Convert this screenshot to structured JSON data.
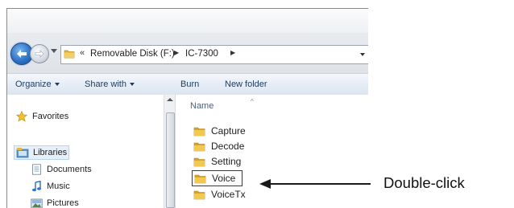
{
  "window": {
    "address": {
      "overflow": "«",
      "crumbs": [
        "Removable Disk (F:)",
        "IC-7300"
      ],
      "separator": "▶"
    },
    "toolbar": {
      "organize": "Organize",
      "share_with": "Share with",
      "burn": "Burn",
      "new_folder": "New folder"
    },
    "nav_pane": {
      "favorites": "Favorites",
      "libraries": "Libraries",
      "documents": "Documents",
      "music": "Music",
      "pictures": "Pictures"
    },
    "content": {
      "column_name": "Name",
      "sort_indicator": "^",
      "items": [
        "Capture",
        "Decode",
        "Setting",
        "Voice",
        "VoiceTx"
      ],
      "highlighted_item": "Voice"
    }
  },
  "annotation": {
    "callout": "Double-click"
  },
  "colors": {
    "accent": "#2e74c6",
    "folder": "#e8b43a",
    "toolbar_text": "#1e3a5f"
  },
  "icons": {
    "back": "back-arrow-icon",
    "forward": "forward-arrow-icon",
    "folder": "folder-icon",
    "star": "star-icon",
    "library": "library-icon",
    "documents": "documents-icon",
    "music": "music-note-icon",
    "pictures": "pictures-icon"
  }
}
